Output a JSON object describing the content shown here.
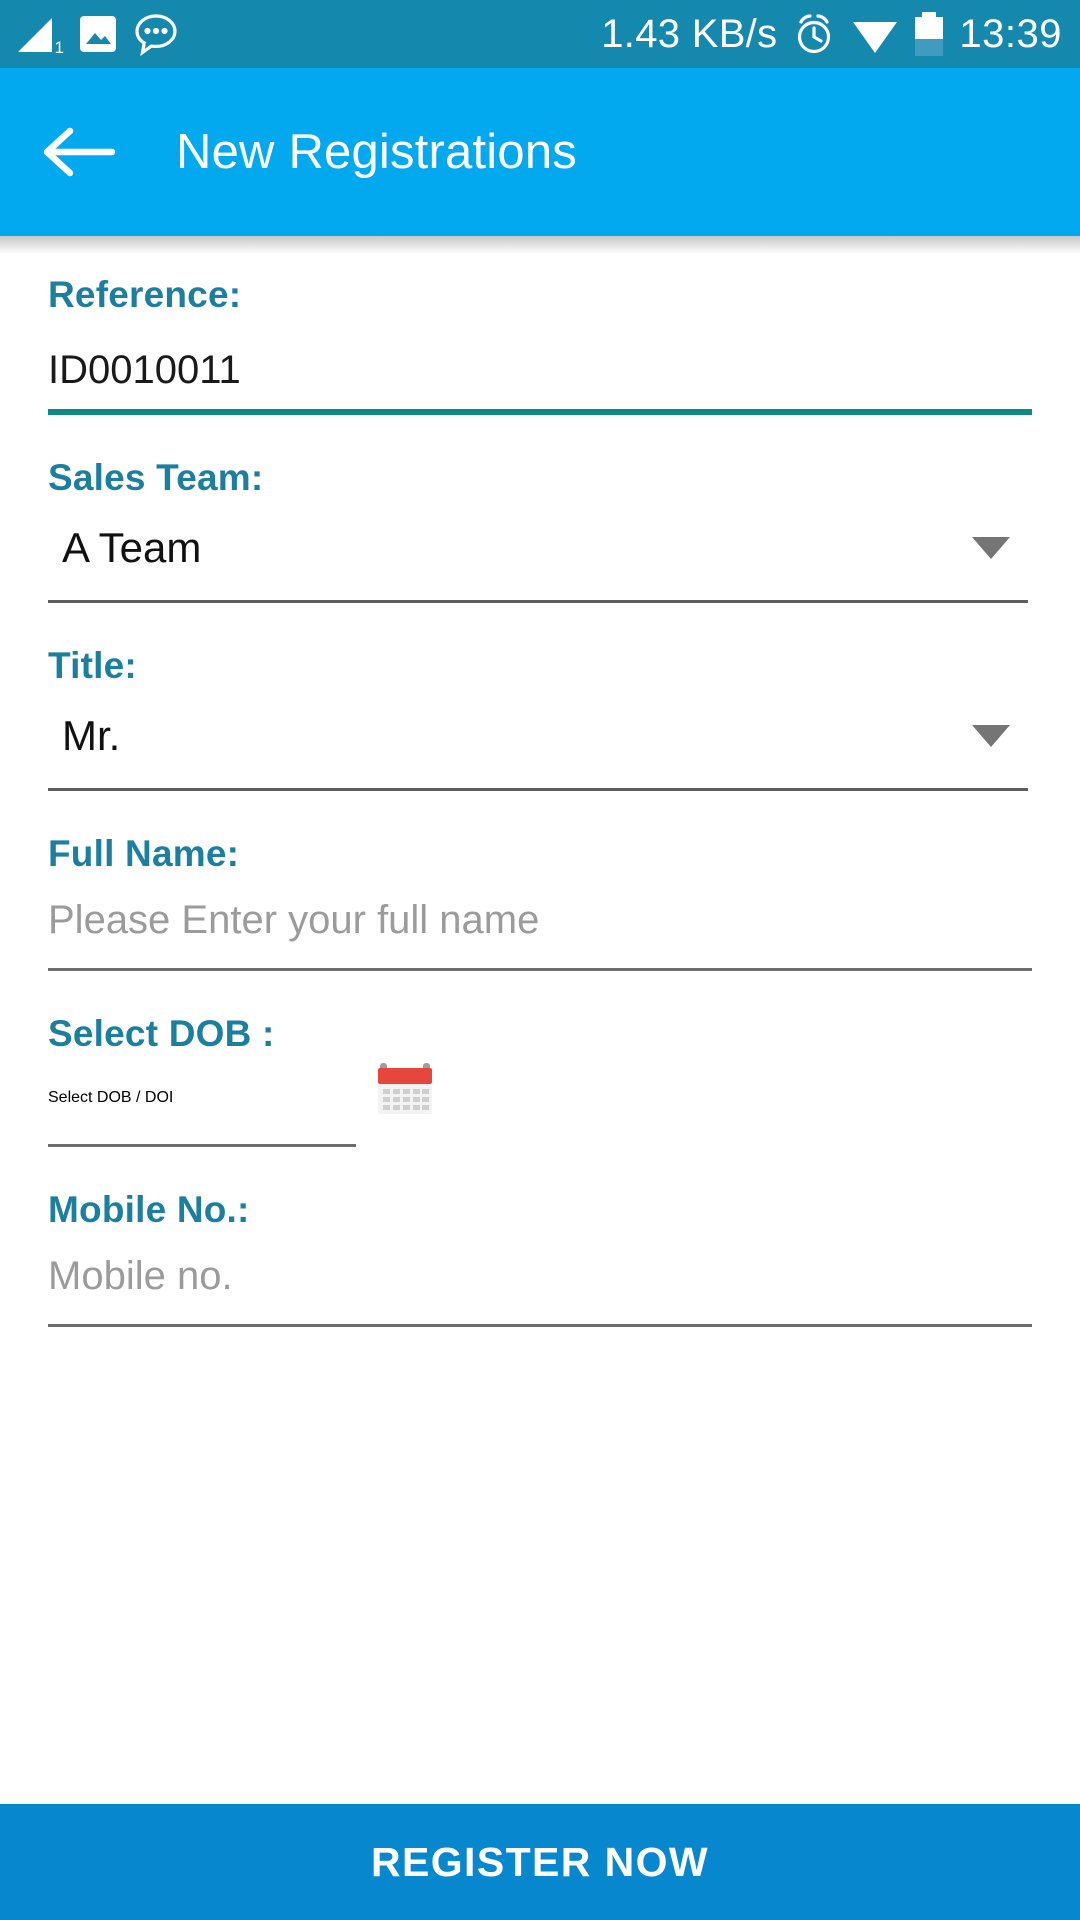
{
  "statusbar": {
    "signal_label": "1",
    "network_speed": "1.43 KB/s",
    "clock": "13:39",
    "icons": [
      "signal-icon",
      "photo-icon",
      "chat-bubble-icon",
      "alarm-icon",
      "wifi-icon",
      "battery-icon"
    ]
  },
  "appbar": {
    "back_icon": "back-arrow-icon",
    "title": "New Registrations",
    "bg_color": "#03a9ef"
  },
  "theme": {
    "label_color": "#1c7fa0",
    "accent_underline": "#0e8a80",
    "statusbar_color": "#1588ae",
    "button_color": "#0787ce"
  },
  "form": {
    "reference": {
      "label": "Reference:",
      "value": "ID0010011"
    },
    "sales_team": {
      "label": "Sales Team:",
      "value": "A Team",
      "caret_icon": "chevron-down-icon"
    },
    "title": {
      "label": "Title:",
      "value": "Mr.",
      "caret_icon": "chevron-down-icon"
    },
    "full_name": {
      "label": "Full Name:",
      "value": "",
      "placeholder": "Please Enter your full name"
    },
    "dob": {
      "label": "Select  DOB :",
      "value": "",
      "placeholder": "Select DOB / DOI",
      "calendar_icon": "calendar-icon"
    },
    "mobile": {
      "label": "Mobile No.:",
      "value": "",
      "placeholder": "Mobile no."
    }
  },
  "footer": {
    "register_label": "REGISTER NOW"
  }
}
